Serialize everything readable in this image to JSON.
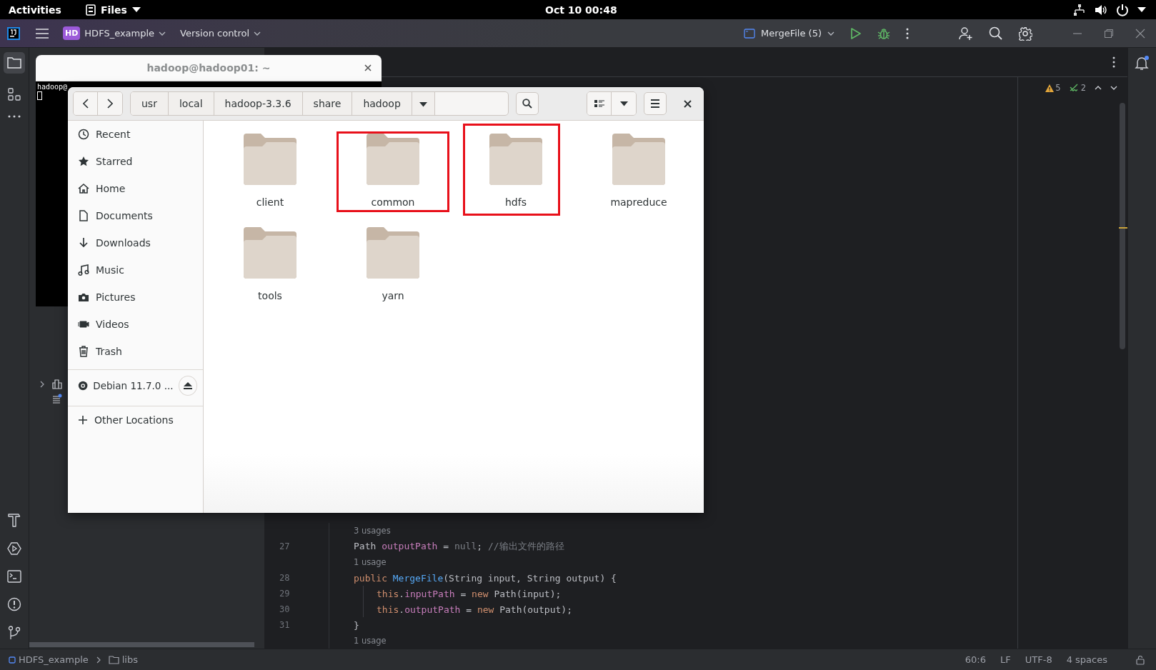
{
  "top_bar": {
    "activities": "Activities",
    "app_menu": "Files",
    "clock": "Oct 10  00:48"
  },
  "ide": {
    "toolbar": {
      "project_badge": "HD",
      "project": "HDFS_example",
      "vcs": "Version control",
      "run_config": "MergeFile (5)"
    },
    "inspections": {
      "warnings": "5",
      "checks": "2"
    },
    "code_lines": [
      {
        "kind": "hint",
        "text": "3 usages"
      },
      {
        "kind": "code",
        "number": "27",
        "indented": false,
        "tokens": [
          {
            "kind": "plain",
            "text": "Path "
          },
          {
            "kind": "field",
            "text": "outputPath"
          },
          {
            "kind": "plain",
            "text": " = "
          },
          {
            "kind": "null",
            "text": "null"
          },
          {
            "kind": "plain",
            "text": "; "
          },
          {
            "kind": "comment",
            "text": "//输出文件的路径"
          }
        ]
      },
      {
        "kind": "hint",
        "text": "1 usage"
      },
      {
        "kind": "code",
        "number": "28",
        "indented": false,
        "tokens": [
          {
            "kind": "keyword",
            "text": "public "
          },
          {
            "kind": "method",
            "text": "MergeFile"
          },
          {
            "kind": "plain",
            "text": "(String input, String output) {"
          }
        ]
      },
      {
        "kind": "code",
        "number": "29",
        "indented": true,
        "tokens": [
          {
            "kind": "keyword",
            "text": "this"
          },
          {
            "kind": "plain",
            "text": "."
          },
          {
            "kind": "field",
            "text": "inputPath"
          },
          {
            "kind": "plain",
            "text": " = "
          },
          {
            "kind": "keyword",
            "text": "new "
          },
          {
            "kind": "plain",
            "text": "Path(input);"
          }
        ]
      },
      {
        "kind": "code",
        "number": "30",
        "indented": true,
        "tokens": [
          {
            "kind": "keyword",
            "text": "this"
          },
          {
            "kind": "plain",
            "text": "."
          },
          {
            "kind": "field",
            "text": "outputPath"
          },
          {
            "kind": "plain",
            "text": " = "
          },
          {
            "kind": "keyword",
            "text": "new "
          },
          {
            "kind": "plain",
            "text": "Path(output);"
          }
        ]
      },
      {
        "kind": "code",
        "number": "31",
        "indented": false,
        "tokens": [
          {
            "kind": "plain",
            "text": "}"
          }
        ]
      },
      {
        "kind": "hint",
        "text": "1 usage"
      }
    ],
    "status_bar": {
      "breadcrumbs": [
        "HDFS_example",
        "libs"
      ],
      "items": [
        "60:6",
        "LF",
        "UTF-8",
        "4 spaces"
      ]
    }
  },
  "terminal": {
    "title": "hadoop@hadoop01: ~",
    "lines": [
      "hadoop@"
    ]
  },
  "files": {
    "path": [
      "usr",
      "local",
      "hadoop-3.3.6",
      "share",
      "hadoop"
    ],
    "places": [
      {
        "kind": "recent",
        "label": "Recent"
      },
      {
        "kind": "starred",
        "label": "Starred"
      },
      {
        "kind": "home",
        "label": "Home"
      },
      {
        "kind": "documents",
        "label": "Documents"
      },
      {
        "kind": "downloads",
        "label": "Downloads"
      },
      {
        "kind": "music",
        "label": "Music"
      },
      {
        "kind": "pictures",
        "label": "Pictures"
      },
      {
        "kind": "videos",
        "label": "Videos"
      },
      {
        "kind": "trash",
        "label": "Trash"
      }
    ],
    "devices": [
      {
        "label": "Debian 11.7.0 ..."
      }
    ],
    "other": "Other Locations",
    "folders": [
      {
        "name": "client",
        "highlighted": false
      },
      {
        "name": "common",
        "highlighted": true
      },
      {
        "name": "hdfs",
        "highlighted": true
      },
      {
        "name": "mapreduce",
        "highlighted": false
      },
      {
        "name": "tools",
        "highlighted": false
      },
      {
        "name": "yarn",
        "highlighted": false
      }
    ]
  }
}
